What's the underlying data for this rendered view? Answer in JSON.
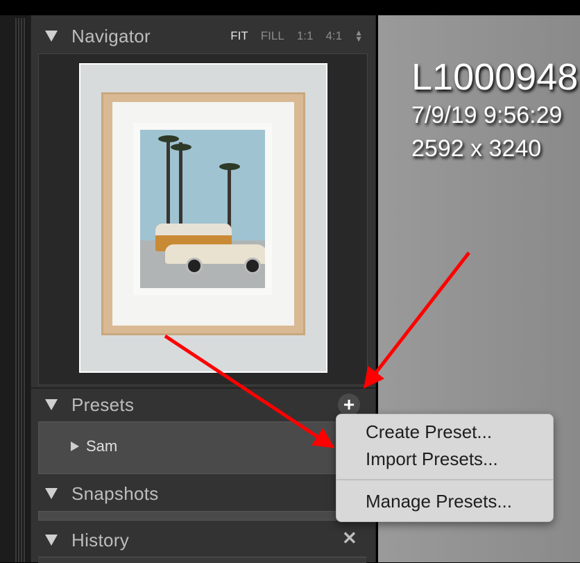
{
  "navigator": {
    "title": "Navigator",
    "zoom_options": [
      "FIT",
      "FILL",
      "1:1",
      "4:1"
    ],
    "active_zoom": "FIT"
  },
  "presets": {
    "title": "Presets",
    "items": [
      {
        "label": "Sam"
      }
    ]
  },
  "snapshots": {
    "title": "Snapshots"
  },
  "history": {
    "title": "History"
  },
  "photo_info": {
    "filename": "L1000948",
    "datetime": "7/9/19 9:56:29",
    "dimensions": "2592 x 3240"
  },
  "preset_menu": {
    "create": "Create Preset...",
    "import": "Import Presets...",
    "manage": "Manage Presets..."
  },
  "colors": {
    "panel_bg": "#333333",
    "menu_bg": "#d8d8d8",
    "arrow": "#ff0000"
  },
  "icons": [
    "disclosure-triangle-icon",
    "plus-icon",
    "close-icon",
    "updown-icon"
  ]
}
